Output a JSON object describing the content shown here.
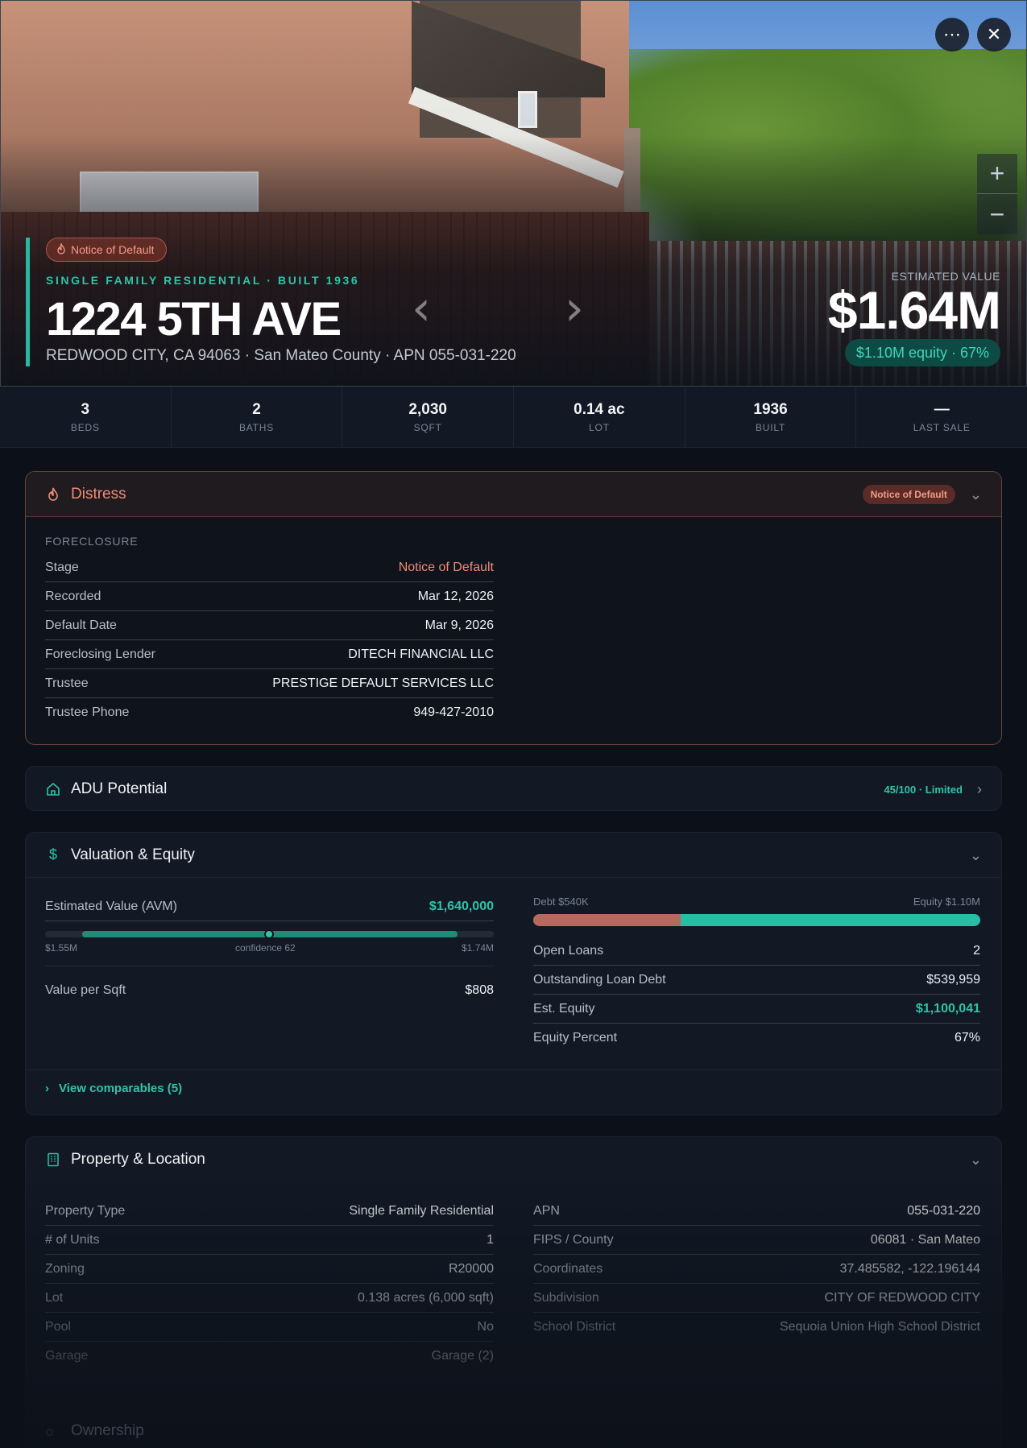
{
  "hero": {
    "badge": "Notice of Default",
    "eyebrow": "SINGLE FAMILY RESIDENTIAL · BUILT 1936",
    "address": "1224 5TH AVE",
    "subaddress": "REDWOOD CITY, CA 94063 · San Mateo County · APN 055-031-220",
    "estimated_value_label": "ESTIMATED VALUE",
    "estimated_value": "$1.64M",
    "equity_pill": "$1.10M equity · 67%",
    "zoom_in": "+",
    "zoom_out": "−"
  },
  "stats": [
    {
      "value": "3",
      "label": "BEDS"
    },
    {
      "value": "2",
      "label": "BATHS"
    },
    {
      "value": "2,030",
      "label": "SQFT"
    },
    {
      "value": "0.14 ac",
      "label": "LOT"
    },
    {
      "value": "1936",
      "label": "BUILT"
    },
    {
      "value": "—",
      "label": "LAST SALE"
    }
  ],
  "distress": {
    "title": "Distress",
    "badge": "Notice of Default",
    "section_label": "FORECLOSURE",
    "rows": [
      {
        "k": "Stage",
        "v": "Notice of Default"
      },
      {
        "k": "Recorded",
        "v": "Mar 12, 2026"
      },
      {
        "k": "Default Date",
        "v": "Mar 9, 2026"
      },
      {
        "k": "Foreclosing Lender",
        "v": "DITECH FINANCIAL LLC"
      },
      {
        "k": "Trustee",
        "v": "PRESTIGE DEFAULT SERVICES LLC"
      },
      {
        "k": "Trustee Phone",
        "v": "949-427-2010"
      }
    ]
  },
  "adu": {
    "title": "ADU Potential",
    "score": "45/100 · Limited"
  },
  "valuation": {
    "title": "Valuation & Equity",
    "avm_label": "Estimated Value (AVM)",
    "avm_value": "$1,640,000",
    "range_low": "$1.55M",
    "confidence": "confidence 62",
    "range_high": "$1.74M",
    "value_per_sqft_label": "Value per Sqft",
    "value_per_sqft": "$808",
    "debt_label": "Debt $540K",
    "equity_label": "Equity $1.10M",
    "debt_fraction": 0.33,
    "rows": [
      {
        "k": "Open Loans",
        "v": "2"
      },
      {
        "k": "Outstanding Loan Debt",
        "v": "$539,959"
      },
      {
        "k": "Est. Equity",
        "v": "$1,100,041"
      },
      {
        "k": "Equity Percent",
        "v": "67%"
      }
    ],
    "comparables_link": "View comparables (5)"
  },
  "property": {
    "title": "Property & Location",
    "left": [
      {
        "k": "Property Type",
        "v": "Single Family Residential"
      },
      {
        "k": "# of Units",
        "v": "1"
      },
      {
        "k": "Zoning",
        "v": "R20000"
      },
      {
        "k": "Lot",
        "v": "0.138 acres (6,000 sqft)"
      },
      {
        "k": "Pool",
        "v": "No"
      },
      {
        "k": "Garage",
        "v": "Garage (2)"
      }
    ],
    "right": [
      {
        "k": "APN",
        "v": "055-031-220"
      },
      {
        "k": "FIPS / County",
        "v": "06081 · San Mateo"
      },
      {
        "k": "Coordinates",
        "v": "37.485582, -122.196144"
      },
      {
        "k": "Subdivision",
        "v": "CITY OF REDWOOD CITY"
      },
      {
        "k": "School District",
        "v": "Sequoia Union High School District"
      }
    ]
  },
  "ownership": {
    "title": "Ownership"
  },
  "colors": {
    "accent": "#2ec4a8",
    "distress": "#f08a76",
    "debt": "#b56a5e"
  }
}
